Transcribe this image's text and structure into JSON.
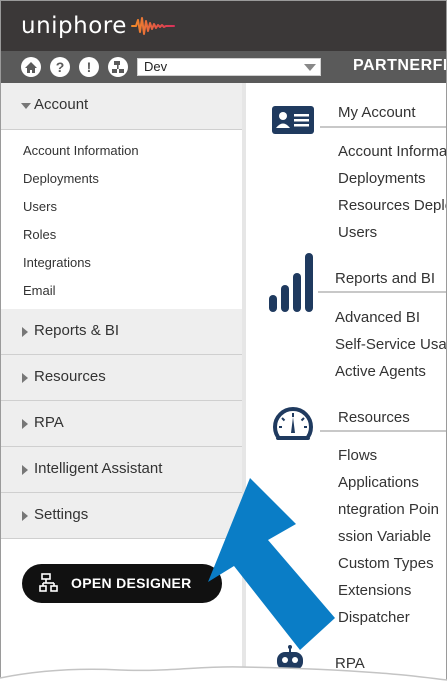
{
  "header": {
    "logo_text": "uniphore",
    "brand_text": "PARTNERFI"
  },
  "toolbar": {
    "environment_value": "Dev"
  },
  "sidebar": {
    "account": {
      "label": "Account",
      "items": [
        "Account Information",
        "Deployments",
        "Users",
        "Roles",
        "Integrations",
        "Email"
      ]
    },
    "sections": [
      "Reports & BI",
      "Resources",
      "RPA",
      "Intelligent Assistant",
      "Settings"
    ],
    "designer_button": "OPEN DESIGNER"
  },
  "main": {
    "my_account": {
      "title": "My Account",
      "links": [
        "Account Informa",
        "Deployments",
        "Resources Deplo",
        "Users"
      ]
    },
    "reports": {
      "title": "Reports and BI",
      "links": [
        "Advanced BI",
        "Self-Service Usag",
        "Active Agents"
      ]
    },
    "resources": {
      "title": "Resources",
      "links": [
        "Flows",
        "Applications",
        "ntegration Poin",
        "ssion Variable",
        "Custom Types",
        "Extensions",
        "Dispatcher"
      ]
    },
    "rpa": {
      "title": "RPA"
    }
  },
  "colors": {
    "topbar": "#3b3838",
    "toolbar": "#5a5a5a",
    "icon_navy": "#1f3a5f",
    "callout_arrow": "#0a7dc6",
    "logo_wave": "#e0563b"
  }
}
